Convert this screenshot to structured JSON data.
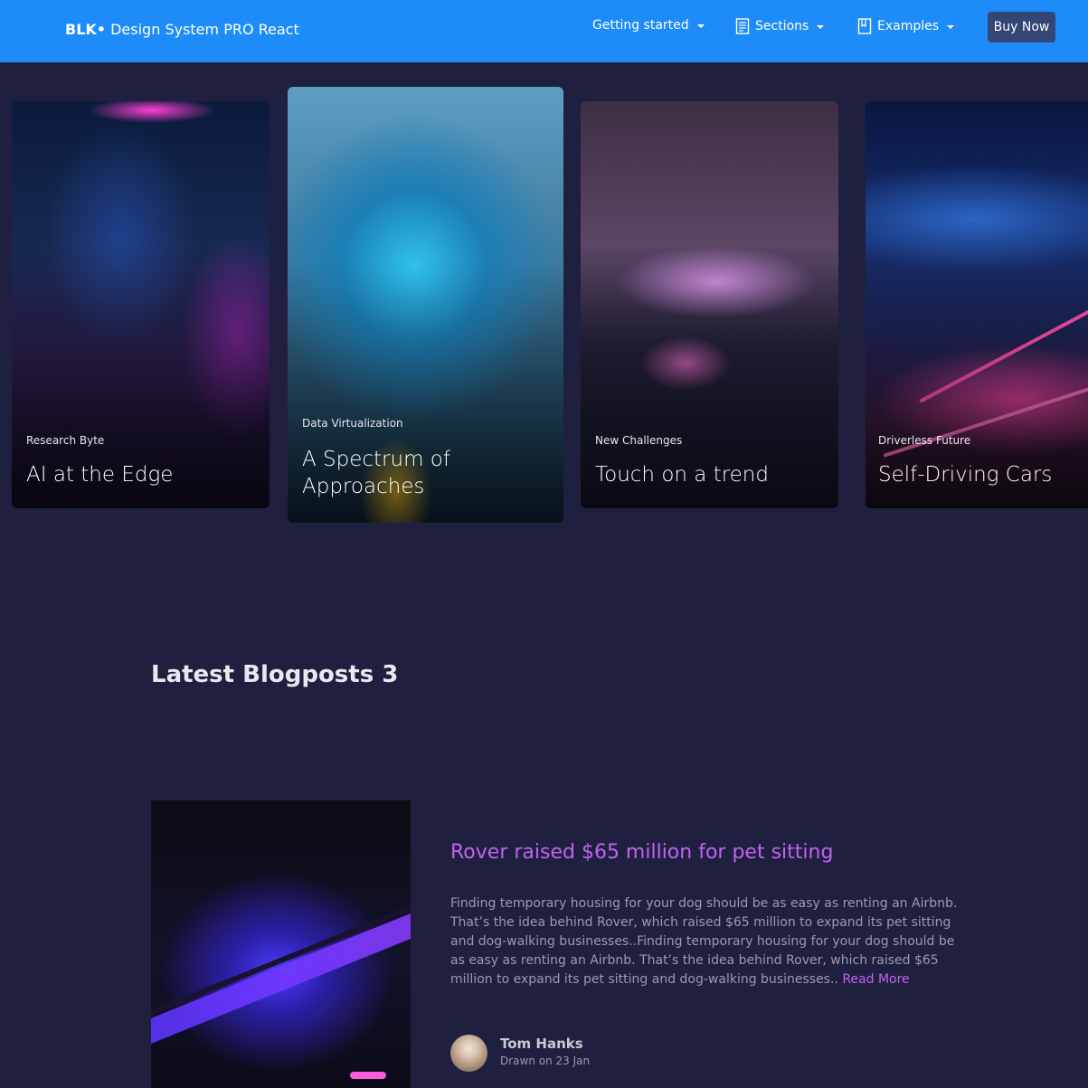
{
  "navbar": {
    "brand_strong": "BLK•",
    "brand_text": "Design System PRO React",
    "items": [
      {
        "label": "Getting started",
        "icon": ""
      },
      {
        "label": "Sections",
        "icon": "paper-icon"
      },
      {
        "label": "Examples",
        "icon": "book-icon"
      }
    ],
    "buy_label": "Buy Now"
  },
  "cards": [
    {
      "category": "Research Byte",
      "title": "AI at the Edge"
    },
    {
      "category": "Data Virtualization",
      "title": "A Spectrum of Approaches"
    },
    {
      "category": "New Challenges",
      "title": "Touch on a trend"
    },
    {
      "category": "Driverless Future",
      "title": "Self-Driving Cars"
    }
  ],
  "blog": {
    "section_title": "Latest Blogposts 3",
    "post": {
      "title": "Rover raised $65 million for pet sitting",
      "text": "Finding temporary housing for your dog should be as easy as renting an Airbnb. That’s the idea behind Rover, which raised $65 million to expand its pet sitting and dog-walking businesses..Finding temporary housing for your dog should be as easy as renting an Airbnb. That’s the idea behind Rover, which raised $65 million to expand its pet sitting and dog-walking businesses..",
      "read_more": "Read More",
      "author": "Tom Hanks",
      "date": "Drawn on 23 Jan"
    }
  },
  "colors": {
    "navbar": "#1d8cf8",
    "background": "#1f2040",
    "accent": "#c063f0",
    "button": "#344675"
  }
}
